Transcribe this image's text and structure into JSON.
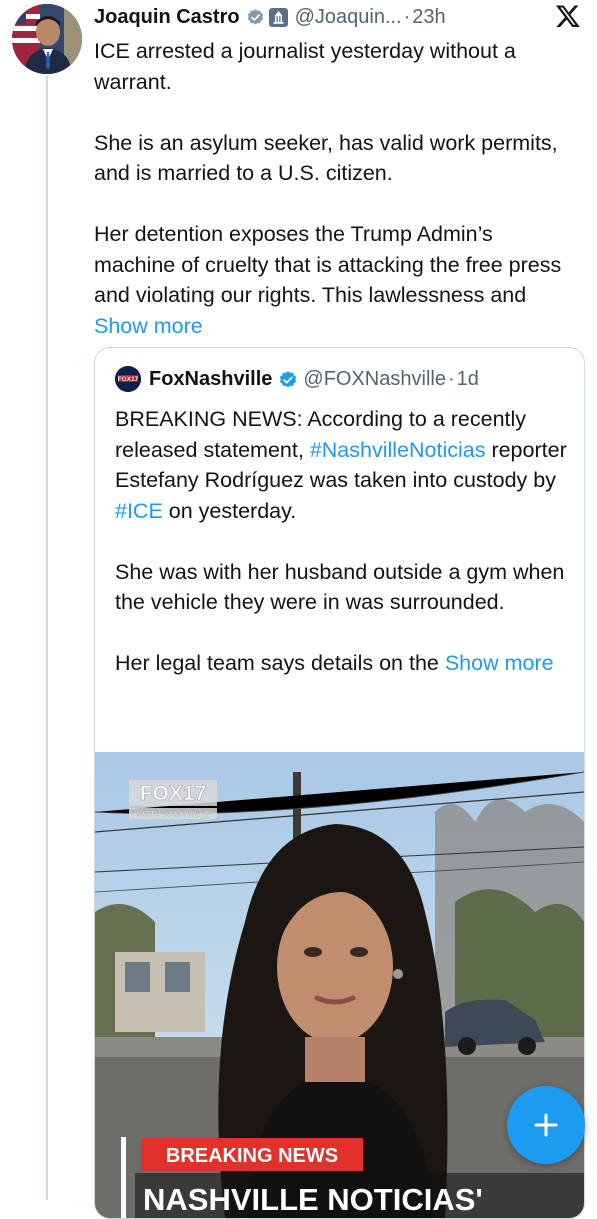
{
  "tweet": {
    "author_name": "Joaquin Castro",
    "handle": "@Joaquin...",
    "separator": "·",
    "time": "23h",
    "paragraph1": "ICE arrested a journalist yesterday without a warrant.",
    "paragraph2": "She is an asylum seeker, has valid work permits, and is married to a U.S. citizen.",
    "paragraph3_text": "Her detention exposes the Trump Admin’s machine of cruelty that is attacking the free press and violating our rights. This lawlessness and ",
    "show_more": "Show more"
  },
  "quote": {
    "author_name": "FoxNashville",
    "handle": "@FOXNashville",
    "separator": "·",
    "time": "1d",
    "p1_part1": "BREAKING NEWS: According to a recently released statement, ",
    "p1_hashtag1": "#NashvilleNoticias",
    "p1_part2": " reporter Estefany Rodríguez was taken into custody by ",
    "p1_hashtag2": "#ICE",
    "p1_part3": " on yesterday.",
    "p2": "She was with her husband outside a gym when the vehicle they were in was surrounded.",
    "p3_text": "Her legal team says details on the ",
    "show_more": "Show more",
    "avatar_text": "FOX17"
  },
  "media": {
    "station_logo": "FOX17",
    "station_sub": "WZTV NASHVILLE",
    "banner": "BREAKING NEWS",
    "headline": "NASHVILLE NOTICIAS'"
  },
  "icons": {
    "verified": "verified-badge-icon",
    "government": "government-badge-icon",
    "x_logo": "x-logo-icon",
    "compose": "plus-icon"
  },
  "colors": {
    "accent": "#1d9bf0",
    "verified": "#829aab",
    "banner_red": "#e0312b"
  }
}
